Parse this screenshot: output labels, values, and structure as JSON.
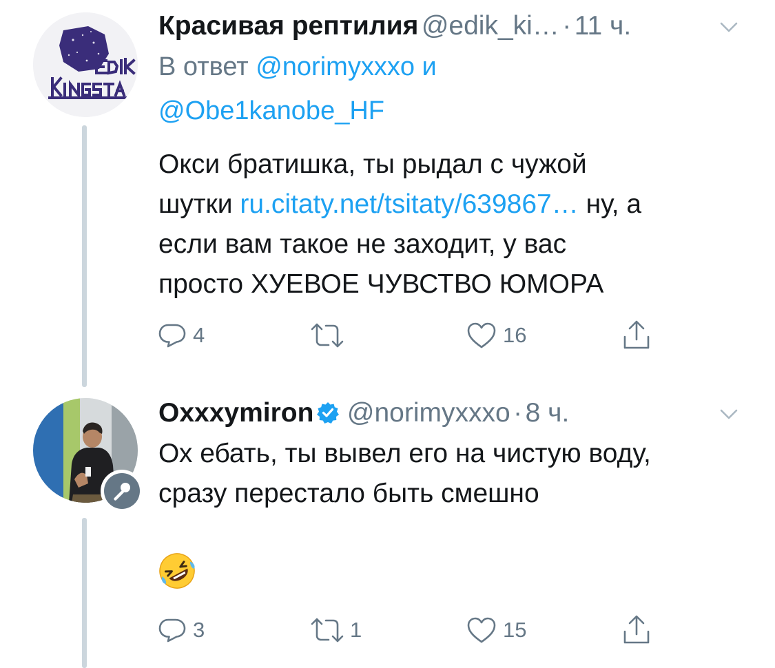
{
  "tweets": [
    {
      "author_name": "Красивая рептилия",
      "handle": "@edik_ki…",
      "separator": "·",
      "time": "11 ч.",
      "reply_prefix": "В ответ",
      "reply_user1": "@norimyxxxo",
      "reply_and": "и",
      "reply_user2": "@Obe1kanobe_HF",
      "text_line1": "Окси братишка, ты рыдал с чужой",
      "text_line2_prefix": "шутки",
      "text_link": "ru.citaty.net/tsitaty/639867…",
      "text_line2_suffix": "ну, а",
      "text_line3": "если вам такое не заходит, у вас",
      "text_line4": "просто ХУЕВОЕ ЧУВСТВО ЮМОРА",
      "replies": "4",
      "retweets": "",
      "likes": "16",
      "avatar_icon": "edik-kingsta-logo-avatar"
    },
    {
      "author_name": "Oxxxymiron",
      "verified": true,
      "handle": "@norimyxxxo",
      "separator": "·",
      "time": "8 ч.",
      "text_line1": "Ох ебать, ты вывел его на чистую воду,",
      "text_line2": "сразу перестало быть смешно",
      "emoji": "rolling-on-floor-laughing-emoji",
      "replies": "3",
      "retweets": "1",
      "likes": "15",
      "avatar_icon": "oxxxymiron-photo-avatar",
      "badge_icon": "microphone-icon"
    }
  ],
  "colors": {
    "link": "#1da1f2",
    "secondary_text": "#657786",
    "thread_line": "#ccd6dd",
    "verified": "#1da1f2"
  }
}
